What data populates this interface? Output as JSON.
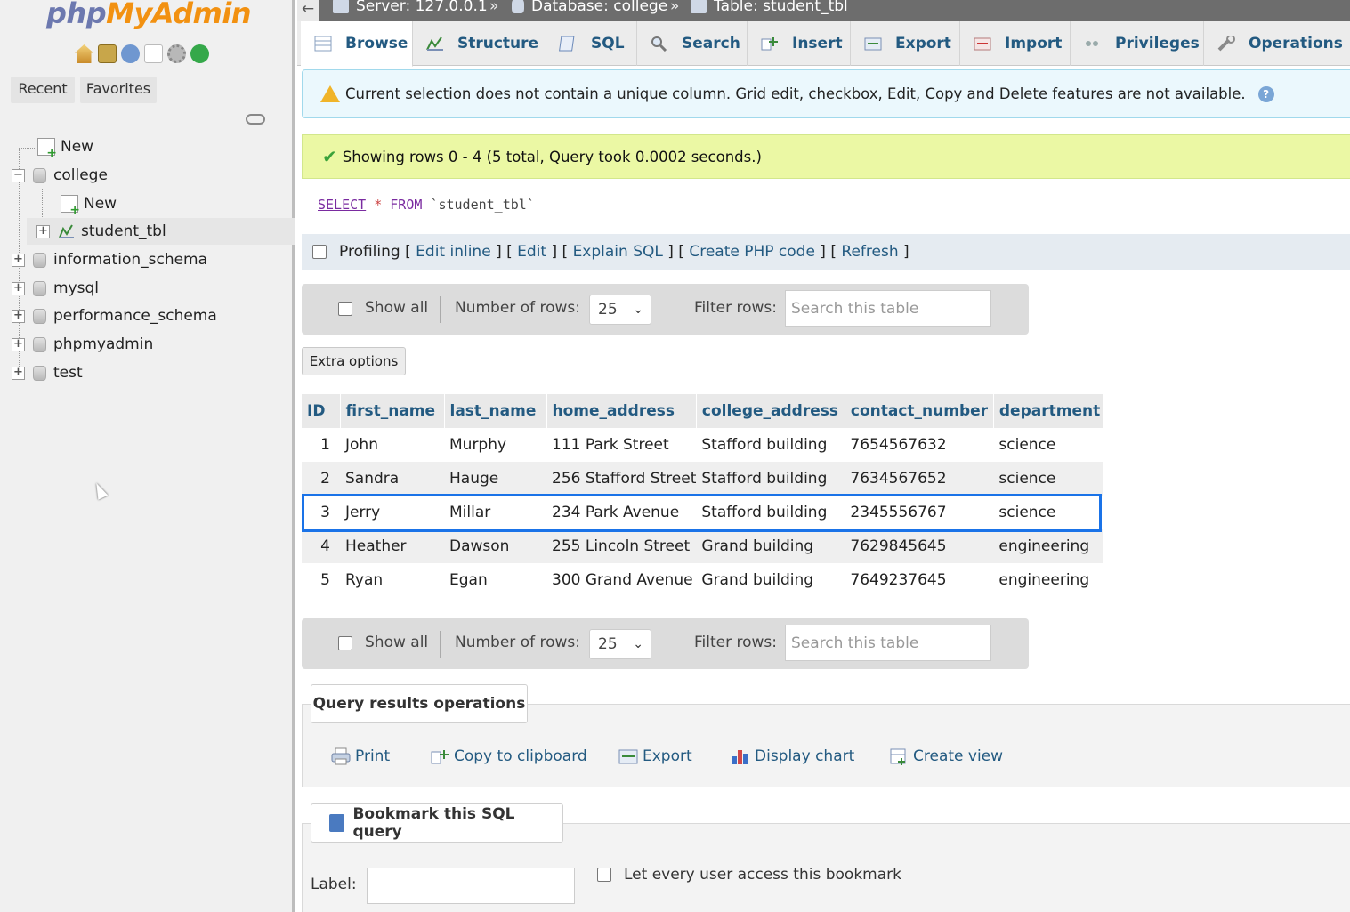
{
  "app": {
    "logo_php": "php",
    "logo_myadmin": "MyAdmin"
  },
  "breadcrumb": {
    "back": "←",
    "server": "Server: 127.0.0.1",
    "sep1": "»",
    "database": "Database: college",
    "sep2": "»",
    "table": "Table: student_tbl"
  },
  "sidebar": {
    "recent": "Recent",
    "favorites": "Favorites",
    "tree": {
      "new_root": "New",
      "college": "college",
      "college_new": "New",
      "student_tbl": "student_tbl",
      "information_schema": "information_schema",
      "mysql": "mysql",
      "performance_schema": "performance_schema",
      "phpmyadmin": "phpmyadmin",
      "test": "test"
    }
  },
  "tabs": {
    "browse": "Browse",
    "structure": "Structure",
    "sql": "SQL",
    "search": "Search",
    "insert": "Insert",
    "export": "Export",
    "import": "Import",
    "privileges": "Privileges",
    "operations": "Operations"
  },
  "notice": "Current selection does not contain a unique column. Grid edit, checkbox, Edit, Copy and Delete features are not available.",
  "success": "Showing rows 0 - 4 (5 total, Query took 0.0002 seconds.)",
  "sql": {
    "select": "SELECT",
    "star": "*",
    "from": "FROM",
    "table": "`student_tbl`"
  },
  "profiling": {
    "label": "Profiling",
    "edit_inline": "Edit inline",
    "edit": "Edit",
    "explain": "Explain SQL",
    "create_php": "Create PHP code",
    "refresh": "Refresh"
  },
  "navctl": {
    "show_all": "Show all",
    "number_of_rows": "Number of rows:",
    "rows_value": "25",
    "filter_rows": "Filter rows:",
    "search_placeholder": "Search this table"
  },
  "extra_options": "Extra options",
  "table": {
    "columns": [
      "ID",
      "first_name",
      "last_name",
      "home_address",
      "college_address",
      "contact_number",
      "department"
    ],
    "rows": [
      [
        "1",
        "John",
        "Murphy",
        "111 Park Street",
        "Stafford building",
        "7654567632",
        "science"
      ],
      [
        "2",
        "Sandra",
        "Hauge",
        "256 Stafford Street",
        "Stafford building",
        "7634567652",
        "science"
      ],
      [
        "3",
        "Jerry",
        "Millar",
        "234 Park Avenue",
        "Stafford building",
        "2345556767",
        "science"
      ],
      [
        "4",
        "Heather",
        "Dawson",
        "255 Lincoln Street",
        "Grand building",
        "7629845645",
        "engineering"
      ],
      [
        "5",
        "Ryan",
        "Egan",
        "300 Grand Avenue",
        "Grand building",
        "7649237645",
        "engineering"
      ]
    ]
  },
  "query_ops": {
    "legend": "Query results operations",
    "print": "Print",
    "copy": "Copy to clipboard",
    "export": "Export",
    "chart": "Display chart",
    "view": "Create view"
  },
  "bookmark": {
    "legend": "Bookmark this SQL query",
    "label": "Label:",
    "every_user": "Let every user access this bookmark"
  },
  "colors": {
    "link": "#235a81",
    "highlight": "#1a73e8",
    "success_bg": "#ebf8a4",
    "notice_bg": "#ebf8fd"
  }
}
